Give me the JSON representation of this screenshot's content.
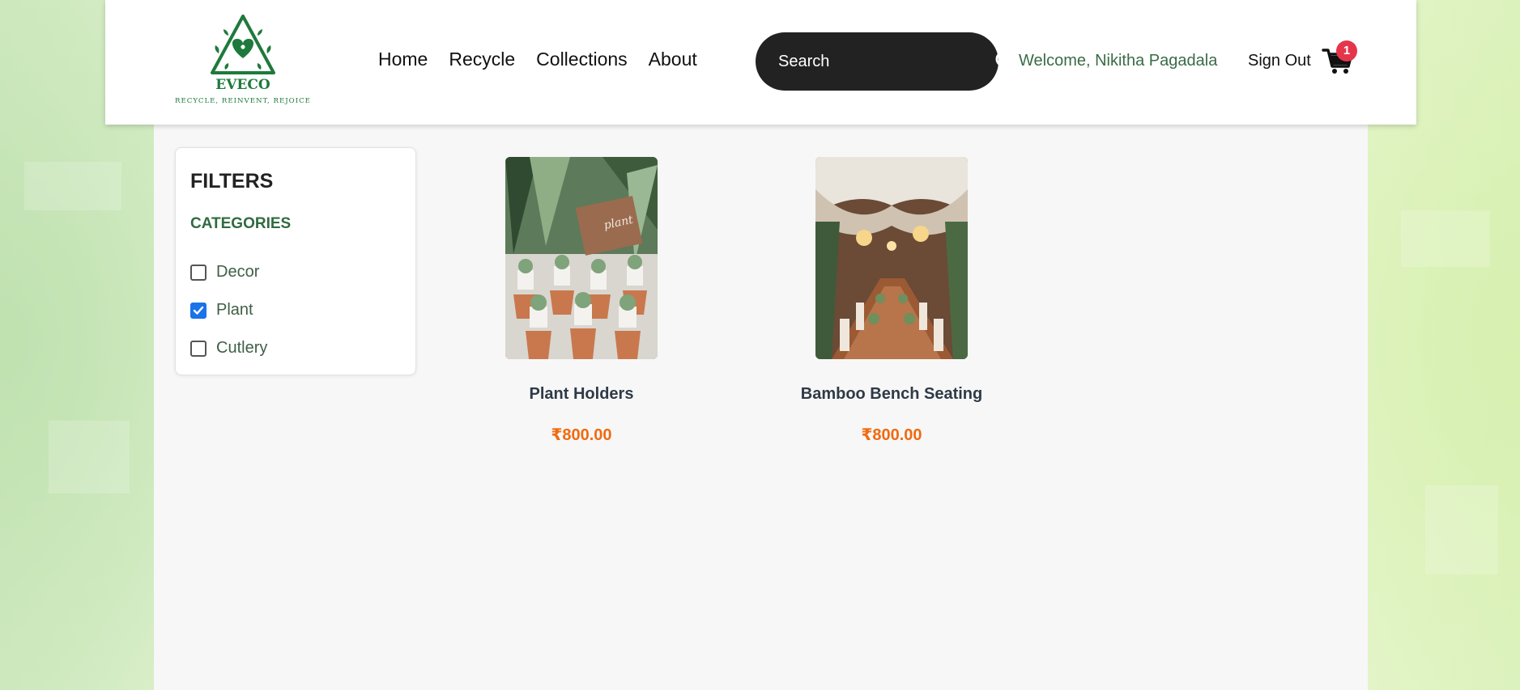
{
  "brand": {
    "name": "EVECO",
    "tagline": "RECYCLE, REINVENT, REJOICE",
    "color": "#1e7a3c"
  },
  "nav": {
    "links": [
      "Home",
      "Recycle",
      "Collections",
      "About"
    ]
  },
  "search": {
    "placeholder": "Search",
    "icon": "search-icon"
  },
  "user": {
    "welcome": "Welcome, Nikitha Pagadala",
    "signout_label": "Sign Out"
  },
  "cart": {
    "count": "1",
    "icon": "cart-icon",
    "badge_color": "#e5354b"
  },
  "filters": {
    "title": "FILTERS",
    "categories_title": "CATEGORIES",
    "categories": [
      {
        "label": "Decor",
        "checked": false
      },
      {
        "label": "Plant",
        "checked": true
      },
      {
        "label": "Cutlery",
        "checked": false
      }
    ]
  },
  "products": [
    {
      "name": "Plant Holders",
      "price": "₹800.00"
    },
    {
      "name": "Bamboo Bench Seating",
      "price": "₹800.00"
    }
  ],
  "colors": {
    "accent_green": "#2f6b3f",
    "price": "#f06a0f",
    "checkbox_checked": "#1a73e8"
  }
}
